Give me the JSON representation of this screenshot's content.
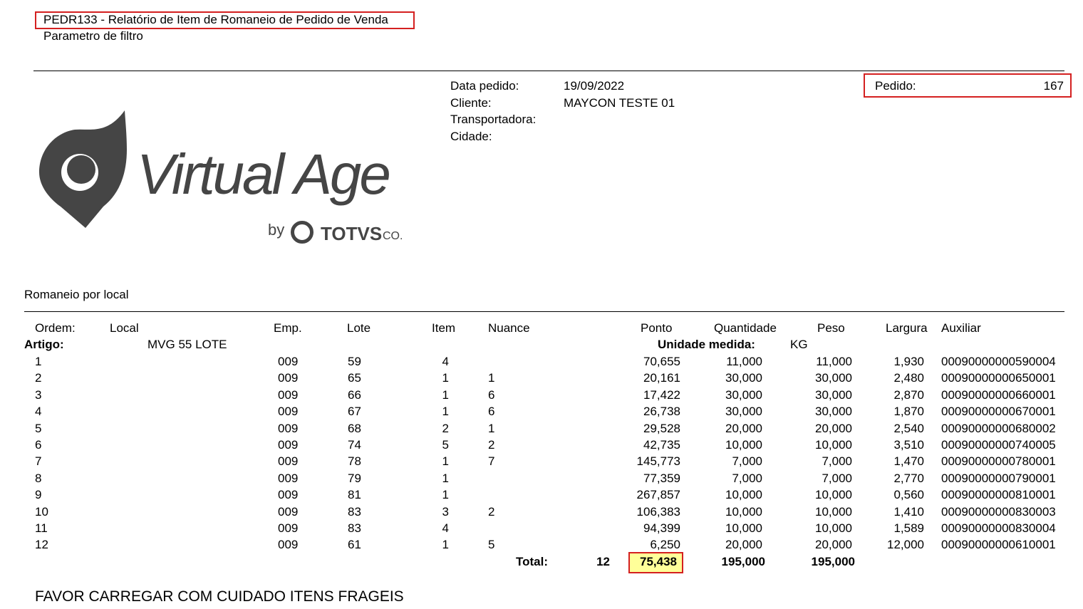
{
  "report": {
    "title": "PEDR133 - Relatório de Item de Romaneio de Pedido de Venda",
    "subtitle": "Parametro de filtro"
  },
  "header": {
    "data_pedido_label": "Data pedido:",
    "data_pedido_value": "19/09/2022",
    "cliente_label": "Cliente:",
    "cliente_value": "MAYCON TESTE 01",
    "transportadora_label": "Transportadora:",
    "cidade_label": "Cidade:",
    "pedido_label": "Pedido:",
    "pedido_value": "167"
  },
  "logo": {
    "name": "Virtual Age",
    "by": "by",
    "totvs": "TOTVS",
    "co": "CO."
  },
  "colors": {
    "highlight_border": "#d42020",
    "total_fill": "#ffff99",
    "logo_gray": "#454545"
  },
  "section": {
    "title": "Romaneio por local"
  },
  "table": {
    "headers": {
      "ordem": "Ordem:",
      "local": "Local",
      "emp": "Emp.",
      "lote": "Lote",
      "item": "Item",
      "nuance": "Nuance",
      "ponto": "Ponto",
      "quantidade": "Quantidade",
      "peso": "Peso",
      "largura": "Largura",
      "auxiliar": "Auxiliar"
    },
    "artigo_label": "Artigo:",
    "artigo_value": "MVG 55 LOTE",
    "unidade_label": "Unidade medida:",
    "unidade_value": "KG",
    "rows": [
      {
        "ordem": "1",
        "emp": "009",
        "lote": "59",
        "item": "4",
        "nuance": "",
        "ponto": "70,655",
        "quantidade": "11,000",
        "peso": "11,000",
        "largura": "1,930",
        "auxiliar": "00090000000590004"
      },
      {
        "ordem": "2",
        "emp": "009",
        "lote": "65",
        "item": "1",
        "nuance": "1",
        "ponto": "20,161",
        "quantidade": "30,000",
        "peso": "30,000",
        "largura": "2,480",
        "auxiliar": "00090000000650001"
      },
      {
        "ordem": "3",
        "emp": "009",
        "lote": "66",
        "item": "1",
        "nuance": "6",
        "ponto": "17,422",
        "quantidade": "30,000",
        "peso": "30,000",
        "largura": "2,870",
        "auxiliar": "00090000000660001"
      },
      {
        "ordem": "4",
        "emp": "009",
        "lote": "67",
        "item": "1",
        "nuance": "6",
        "ponto": "26,738",
        "quantidade": "30,000",
        "peso": "30,000",
        "largura": "1,870",
        "auxiliar": "00090000000670001"
      },
      {
        "ordem": "5",
        "emp": "009",
        "lote": "68",
        "item": "2",
        "nuance": "1",
        "ponto": "29,528",
        "quantidade": "20,000",
        "peso": "20,000",
        "largura": "2,540",
        "auxiliar": "00090000000680002"
      },
      {
        "ordem": "6",
        "emp": "009",
        "lote": "74",
        "item": "5",
        "nuance": "2",
        "ponto": "42,735",
        "quantidade": "10,000",
        "peso": "10,000",
        "largura": "3,510",
        "auxiliar": "00090000000740005"
      },
      {
        "ordem": "7",
        "emp": "009",
        "lote": "78",
        "item": "1",
        "nuance": "7",
        "ponto": "145,773",
        "quantidade": "7,000",
        "peso": "7,000",
        "largura": "1,470",
        "auxiliar": "00090000000780001"
      },
      {
        "ordem": "8",
        "emp": "009",
        "lote": "79",
        "item": "1",
        "nuance": "",
        "ponto": "77,359",
        "quantidade": "7,000",
        "peso": "7,000",
        "largura": "2,770",
        "auxiliar": "00090000000790001"
      },
      {
        "ordem": "9",
        "emp": "009",
        "lote": "81",
        "item": "1",
        "nuance": "",
        "ponto": "267,857",
        "quantidade": "10,000",
        "peso": "10,000",
        "largura": "0,560",
        "auxiliar": "00090000000810001"
      },
      {
        "ordem": "10",
        "emp": "009",
        "lote": "83",
        "item": "3",
        "nuance": "2",
        "ponto": "106,383",
        "quantidade": "10,000",
        "peso": "10,000",
        "largura": "1,410",
        "auxiliar": "00090000000830003"
      },
      {
        "ordem": "11",
        "emp": "009",
        "lote": "83",
        "item": "4",
        "nuance": "",
        "ponto": "94,399",
        "quantidade": "10,000",
        "peso": "10,000",
        "largura": "1,589",
        "auxiliar": "00090000000830004"
      },
      {
        "ordem": "12",
        "emp": "009",
        "lote": "61",
        "item": "1",
        "nuance": "5",
        "ponto": "6,250",
        "quantidade": "20,000",
        "peso": "20,000",
        "largura": "12,000",
        "auxiliar": "00090000000610001"
      }
    ],
    "total": {
      "label": "Total:",
      "count": "12",
      "ponto": "75,438",
      "quantidade": "195,000",
      "peso": "195,000"
    }
  },
  "footer": {
    "note": "FAVOR CARREGAR COM CUIDADO ITENS FRAGEIS"
  }
}
